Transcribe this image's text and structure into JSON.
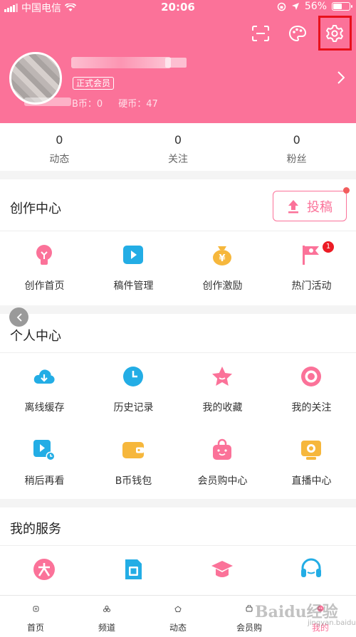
{
  "status": {
    "carrier": "中国电信",
    "time": "20:06",
    "battery": "56%",
    "battery_level": 0.56
  },
  "profile": {
    "vip_badge": "正式会员",
    "b_coin": "B币：0",
    "hard_coin": "硬币：47"
  },
  "stats": [
    {
      "num": "0",
      "label": "动态"
    },
    {
      "num": "0",
      "label": "关注"
    },
    {
      "num": "0",
      "label": "粉丝"
    }
  ],
  "create": {
    "title": "创作中心",
    "upload_label": "投稿",
    "items": [
      "创作首页",
      "稿件管理",
      "创作激励",
      "热门活动"
    ],
    "hot_badge": "1"
  },
  "personal": {
    "title": "个人中心",
    "items": [
      "离线缓存",
      "历史记录",
      "我的收藏",
      "我的关注",
      "稍后再看",
      "B币钱包",
      "会员购中心",
      "直播中心"
    ]
  },
  "services": {
    "title": "我的服务"
  },
  "tabs": [
    "首页",
    "频道",
    "动态",
    "会员购",
    "我的"
  ],
  "watermark": {
    "logo": "Baidu经验",
    "url": "jingyan.baidu.com"
  },
  "colors": {
    "accent": "#fb7299",
    "blue": "#23ade5",
    "yellow": "#f6b73c",
    "highlight": "#e8101c"
  }
}
